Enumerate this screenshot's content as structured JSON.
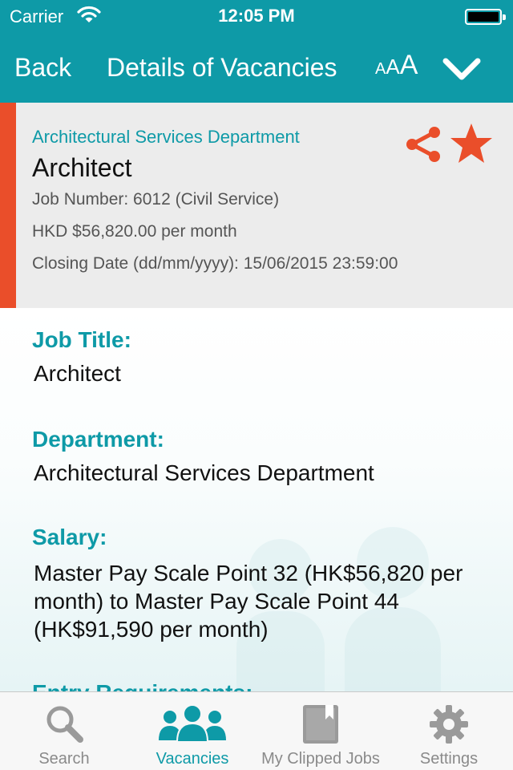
{
  "status_bar": {
    "carrier": "Carrier",
    "time": "12:05 PM"
  },
  "nav": {
    "back_label": "Back",
    "title": "Details of Vacancies",
    "font_size_glyphs": [
      "A",
      "A",
      "A"
    ]
  },
  "summary": {
    "department": "Architectural Services Department",
    "job_name": "Architect",
    "job_number": "Job Number: 6012 (Civil Service)",
    "salary": "HKD $56,820.00 per month",
    "closing_date": "Closing Date (dd/mm/yyyy): 15/06/2015 23:59:00"
  },
  "details": {
    "job_title_label": "Job Title:",
    "job_title_value": "Architect",
    "department_label": "Department:",
    "department_value": "Architectural Services Department",
    "salary_label": "Salary:",
    "salary_value": "Master Pay Scale Point 32 (HK$56,820 per month) to Master Pay Scale Point 44 (HK$91,590 per month)",
    "entry_requirements_label": "Entry Requirements:"
  },
  "tabs": [
    {
      "label": "Search",
      "icon": "search-icon",
      "active": false
    },
    {
      "label": "Vacancies",
      "icon": "people-icon",
      "active": true
    },
    {
      "label": "My Clipped Jobs",
      "icon": "book-icon",
      "active": false
    },
    {
      "label": "Settings",
      "icon": "gear-icon",
      "active": false
    }
  ],
  "colors": {
    "brand_teal": "#0e9aa7",
    "accent_orange": "#ea4e2a",
    "summary_bg": "#ececec"
  }
}
